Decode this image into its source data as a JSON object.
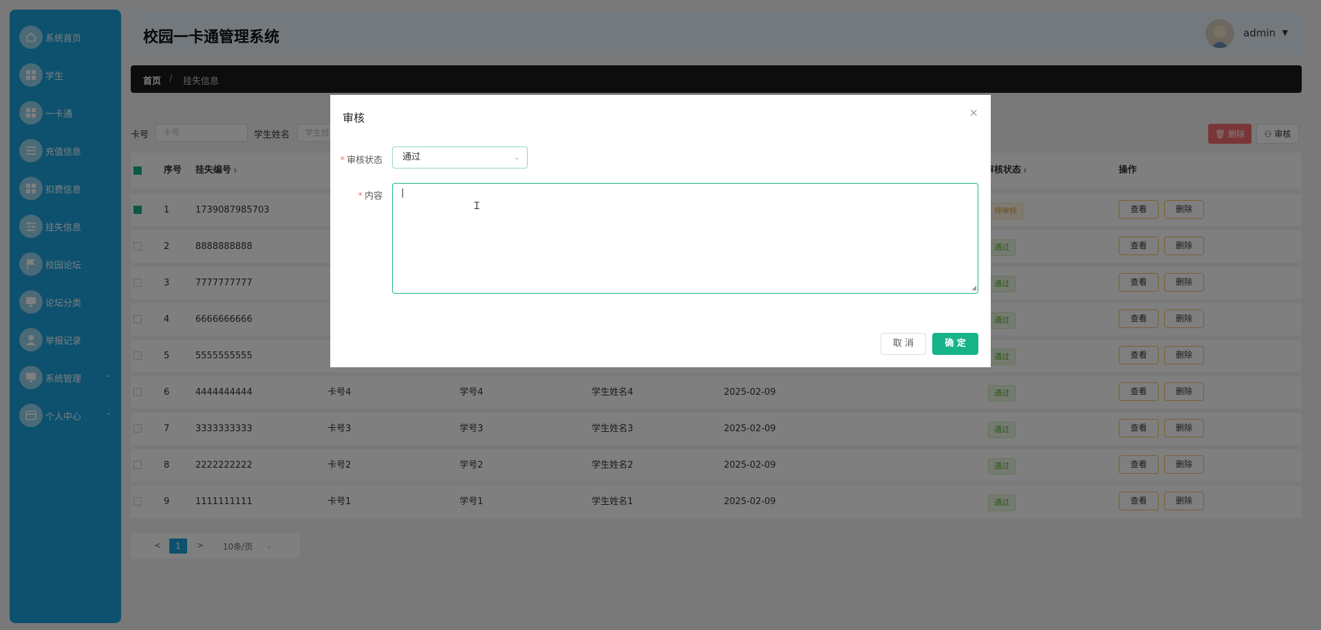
{
  "app": {
    "title": "校园一卡通管理系统",
    "user": "admin"
  },
  "sidebar": {
    "items": [
      {
        "label": "系统首页",
        "icon": "home-icon"
      },
      {
        "label": "学生",
        "icon": "grid-icon"
      },
      {
        "label": "一卡通",
        "icon": "grid-icon"
      },
      {
        "label": "充值信息",
        "icon": "list-icon"
      },
      {
        "label": "扣费信息",
        "icon": "grid-icon"
      },
      {
        "label": "挂失信息",
        "icon": "sliders-icon"
      },
      {
        "label": "校园论坛",
        "icon": "flag-icon"
      },
      {
        "label": "论坛分类",
        "icon": "monitor-icon"
      },
      {
        "label": "举报记录",
        "icon": "user-icon"
      },
      {
        "label": "系统管理",
        "icon": "monitor-icon"
      },
      {
        "label": "个人中心",
        "icon": "card-icon"
      }
    ]
  },
  "breadcrumb": {
    "home": "首页",
    "separator": "/",
    "current": "挂失信息"
  },
  "search": {
    "card_label": "卡号",
    "card_placeholder": "卡号",
    "name_label": "学生姓名",
    "name_placeholder": "学生姓名"
  },
  "toolbar": {
    "delete_label": "删除",
    "audit_label": "审核"
  },
  "table": {
    "headers": {
      "index": "序号",
      "loss_no": "挂失编号",
      "audit_status": "审核状态",
      "actions": "操作"
    },
    "rows": [
      {
        "index": "1",
        "loss_no": "1739087985703",
        "card": "",
        "student_no": "",
        "student_name": "",
        "date": "",
        "status": "待审核",
        "status_type": "pending",
        "checked": true
      },
      {
        "index": "2",
        "loss_no": "8888888888",
        "card": "",
        "student_no": "",
        "student_name": "",
        "date": "",
        "status": "通过",
        "status_type": "pass",
        "checked": false
      },
      {
        "index": "3",
        "loss_no": "7777777777",
        "card": "",
        "student_no": "",
        "student_name": "",
        "date": "",
        "status": "通过",
        "status_type": "pass",
        "checked": false
      },
      {
        "index": "4",
        "loss_no": "6666666666",
        "card": "",
        "student_no": "",
        "student_name": "",
        "date": "",
        "status": "通过",
        "status_type": "pass",
        "checked": false
      },
      {
        "index": "5",
        "loss_no": "5555555555",
        "card": "",
        "student_no": "",
        "student_name": "",
        "date": "",
        "status": "通过",
        "status_type": "pass",
        "checked": false
      },
      {
        "index": "6",
        "loss_no": "4444444444",
        "card": "卡号4",
        "student_no": "学号4",
        "student_name": "学生姓名4",
        "date": "2025-02-09",
        "status": "通过",
        "status_type": "pass",
        "checked": false
      },
      {
        "index": "7",
        "loss_no": "3333333333",
        "card": "卡号3",
        "student_no": "学号3",
        "student_name": "学生姓名3",
        "date": "2025-02-09",
        "status": "通过",
        "status_type": "pass",
        "checked": false
      },
      {
        "index": "8",
        "loss_no": "2222222222",
        "card": "卡号2",
        "student_no": "学号2",
        "student_name": "学生姓名2",
        "date": "2025-02-09",
        "status": "通过",
        "status_type": "pass",
        "checked": false
      },
      {
        "index": "9",
        "loss_no": "1111111111",
        "card": "卡号1",
        "student_no": "学号1",
        "student_name": "学生姓名1",
        "date": "2025-02-09",
        "status": "通过",
        "status_type": "pass",
        "checked": false
      }
    ],
    "view_label": "查看",
    "delete_label": "删除"
  },
  "pagination": {
    "prev": "<",
    "current": "1",
    "next": ">",
    "page_size": "10条/页"
  },
  "modal": {
    "title": "审核",
    "close": "×",
    "status_label": "审核状态",
    "status_value": "通过",
    "content_label": "内容",
    "content_value": "|",
    "cancel_label": "取 消",
    "confirm_label": "确 定"
  },
  "colors": {
    "accent": "#17b389",
    "sidebar": "#1aa3dc",
    "danger": "#f56c6c"
  }
}
